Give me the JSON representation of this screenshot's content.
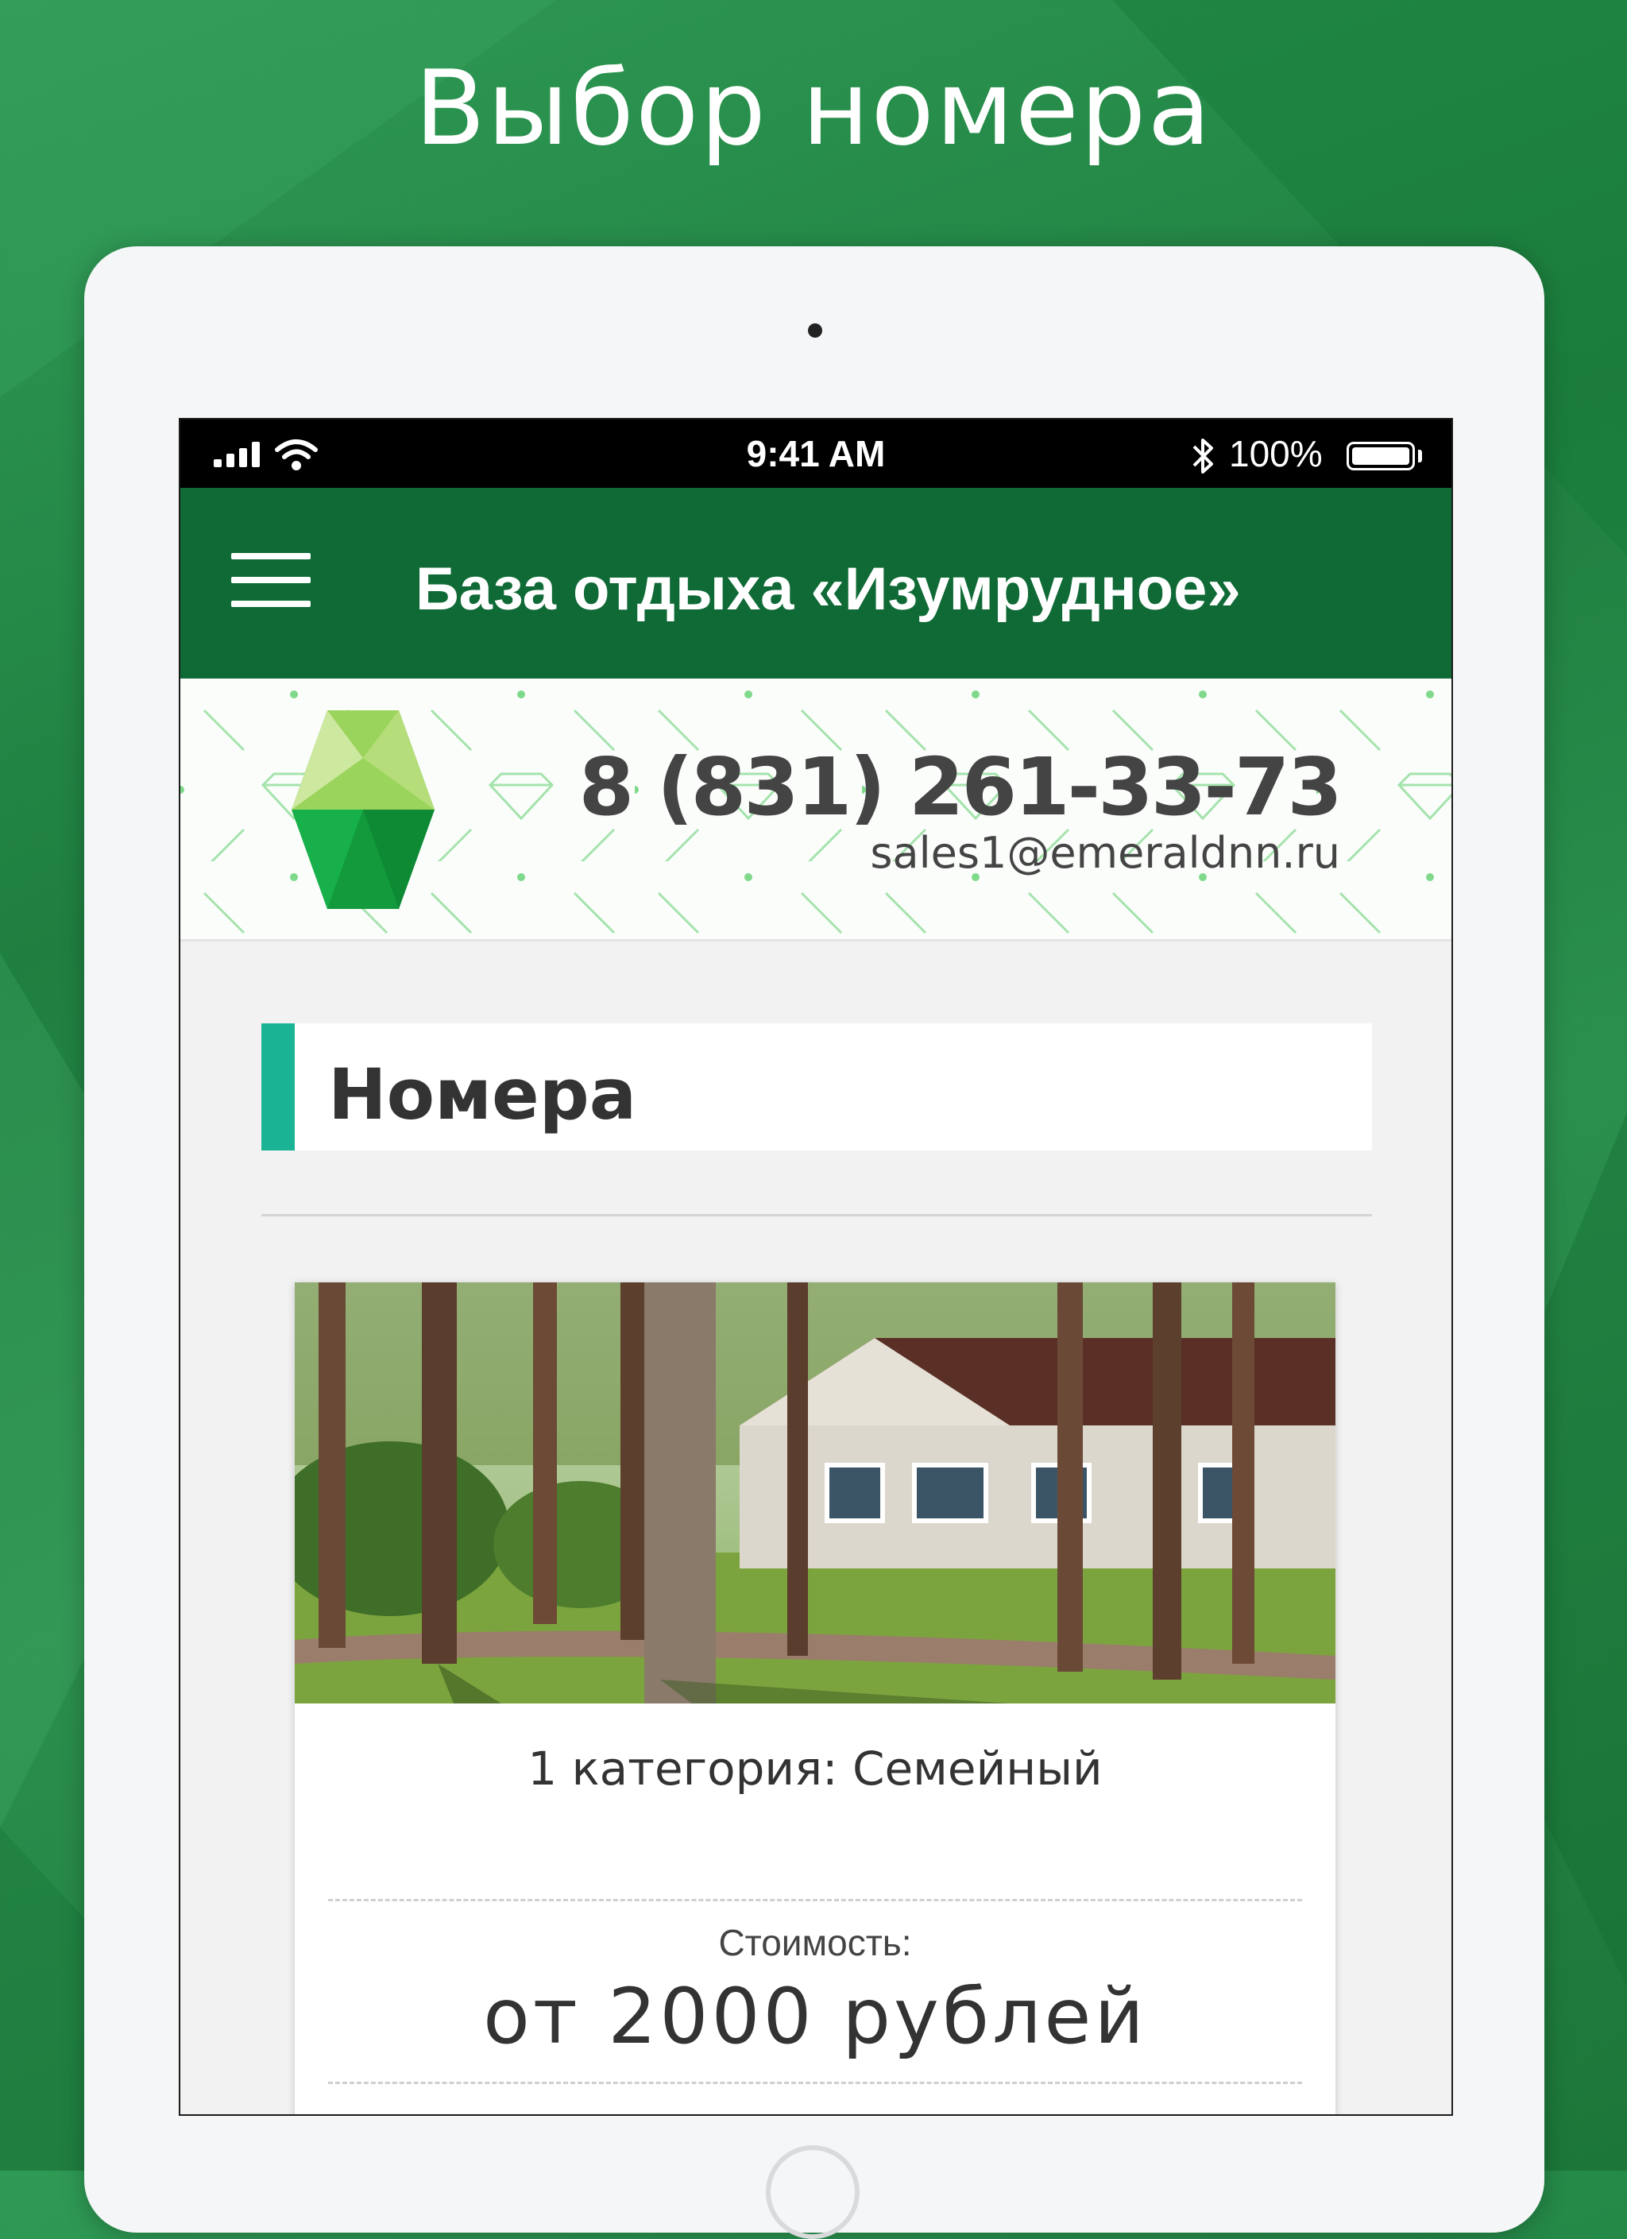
{
  "page": {
    "title": "Выбор номера"
  },
  "status_bar": {
    "time": "9:41 AM",
    "battery": "100%"
  },
  "app_bar": {
    "title": "База отдыха «Изумрудное»",
    "menu_icon": "menu-icon"
  },
  "contacts": {
    "phone": "8 (831) 261-33-73",
    "email": "sales1@emeraldnn.ru"
  },
  "section": {
    "title": "Номера"
  },
  "room": {
    "name": "1 категория: Семейный",
    "price_label": "Стоимость:",
    "price_value": "от 2000 рублей"
  },
  "colors": {
    "background": "#2b8f4d",
    "app_bar": "#0f6a36",
    "section_accent": "#1ab394"
  }
}
